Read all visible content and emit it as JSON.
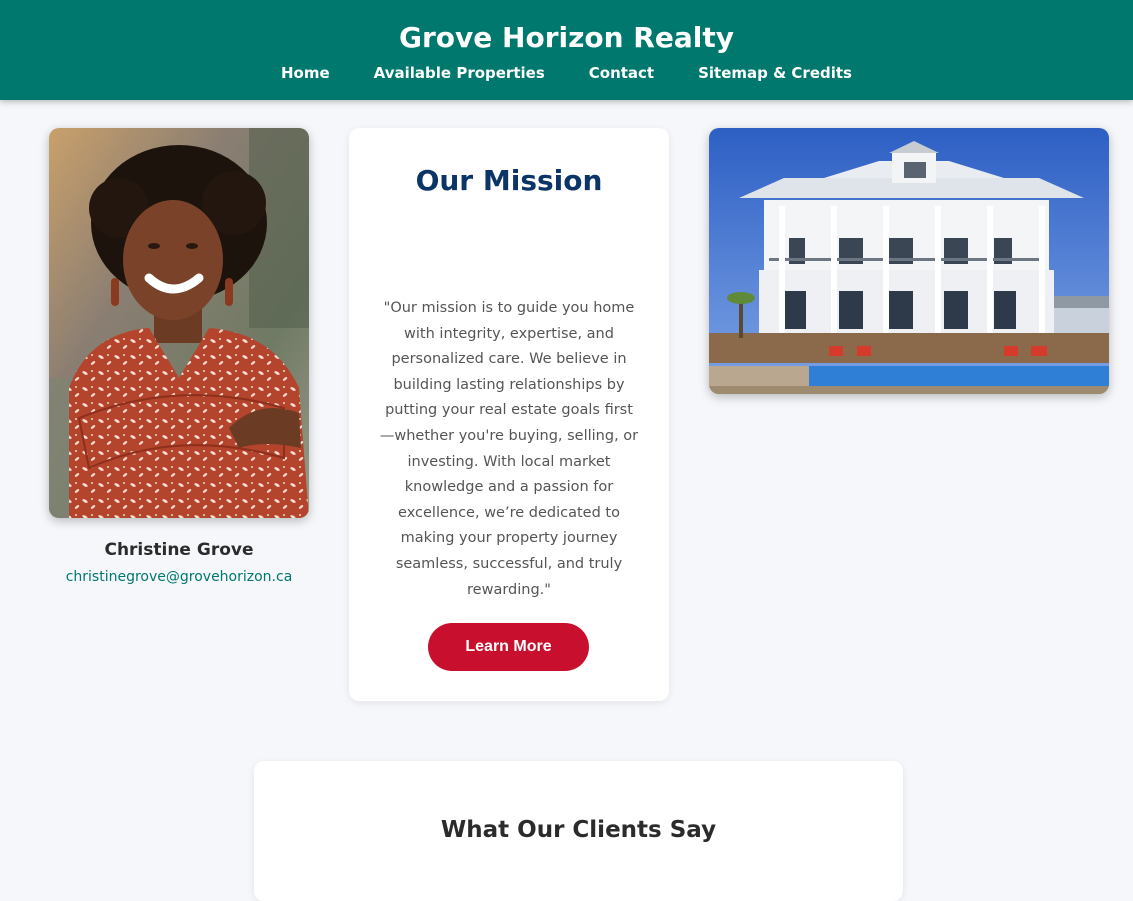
{
  "header": {
    "title": "Grove Horizon Realty",
    "nav": [
      "Home",
      "Available Properties",
      "Contact",
      "Sitemap & Credits"
    ]
  },
  "agent": {
    "name": "Christine Grove",
    "email": "christinegrove@grovehorizon.ca"
  },
  "mission": {
    "title": "Our Mission",
    "text": "\"Our mission is to guide you home with integrity, expertise, and personalized care. We believe in building lasting relationships by putting your real estate goals first—whether you're buying, selling, or investing. With local market knowledge and a passion for excellence, we’re dedicated to making your property journey seamless, successful, and truly rewarding.\"",
    "button_label": "Learn More"
  },
  "testimonials": {
    "title": "What Our Clients Say"
  },
  "colors": {
    "header_bg": "#00786d",
    "mission_title": "#0a3566",
    "button_bg": "#c8102e",
    "page_bg": "#f5f7fa"
  }
}
